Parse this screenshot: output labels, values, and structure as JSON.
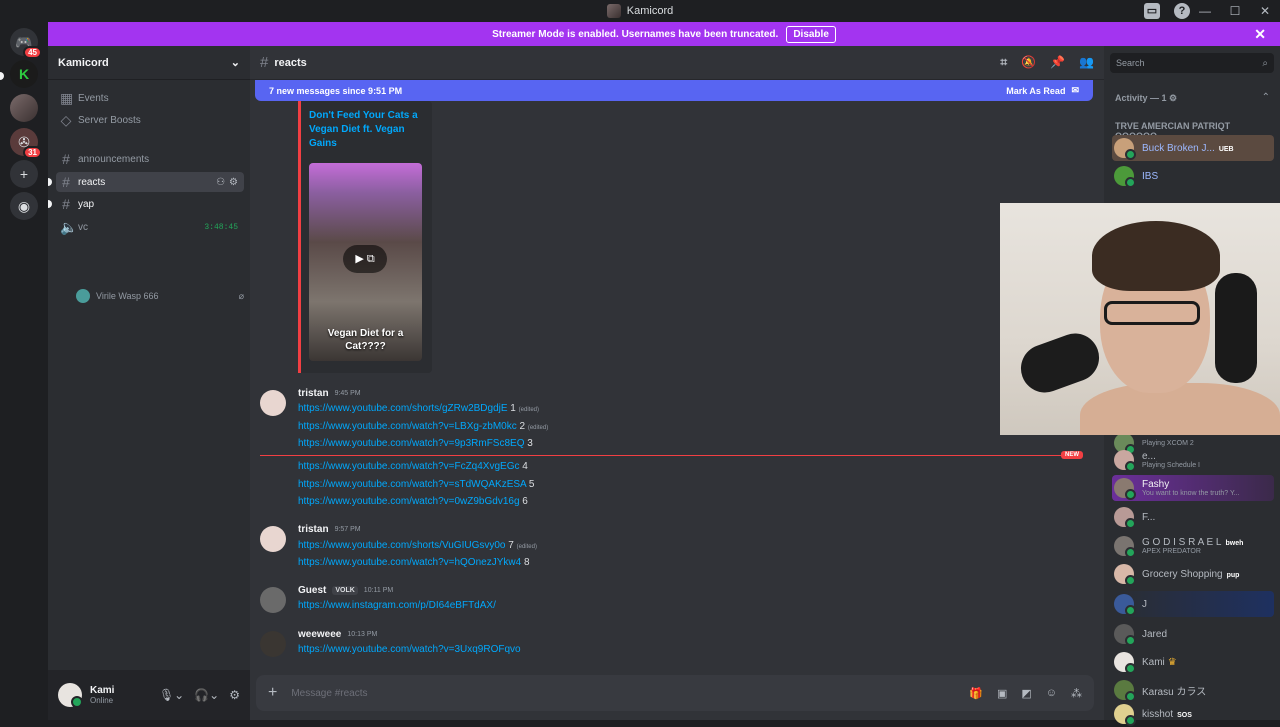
{
  "window": {
    "title": "Kamicord"
  },
  "streamer_bar": {
    "text": "Streamer Mode is enabled. Usernames have been truncated.",
    "button": "Disable"
  },
  "guilds": [
    {
      "badge": "45"
    },
    {
      "badge": ""
    },
    {
      "badge": ""
    },
    {
      "badge": "31"
    }
  ],
  "sidebar": {
    "server_name": "Kamicord",
    "items": [
      {
        "label": "Events"
      },
      {
        "label": "Server Boosts"
      },
      {
        "label": "announcements"
      },
      {
        "label": "reacts"
      },
      {
        "label": "yap"
      },
      {
        "label": "vc",
        "time": "3:48:45"
      }
    ],
    "vc_user": "Virile Wasp 666"
  },
  "user_panel": {
    "name": "Kami",
    "status": "Online"
  },
  "chat": {
    "channel": "reacts",
    "new_bar": {
      "text": "7 new messages since 9:51 PM",
      "mark": "Mark As Read"
    },
    "embed": {
      "title": "Don't Feed Your Cats a Vegan Diet ft. Vegan Gains",
      "caption": "Vegan Diet for a Cat????"
    },
    "new_label": "NEW",
    "messages": [
      {
        "author": "tristan",
        "time": "9:45 PM",
        "lines": [
          {
            "url": "https://www.youtube.com/shorts/gZRw2BDgdjE",
            "suffix": " 1",
            "edited": "(edited)"
          },
          {
            "url": "https://www.youtube.com/watch?v=LBXg-zbM0kc",
            "suffix": " 2",
            "edited": "(edited)"
          },
          {
            "url": "https://www.youtube.com/watch?v=9p3RmFSc8EQ",
            "suffix": " 3",
            "edited": ""
          },
          {
            "url": "https://www.youtube.com/watch?v=FcZq4XvgEGc",
            "suffix": " 4",
            "edited": ""
          },
          {
            "url": "https://www.youtube.com/watch?v=sTdWQAKzESA",
            "suffix": " 5",
            "edited": ""
          },
          {
            "url": "https://www.youtube.com/watch?v=0wZ9bGdv16g",
            "suffix": " 6",
            "edited": ""
          }
        ]
      },
      {
        "author": "tristan",
        "time": "9:57 PM",
        "lines": [
          {
            "url": "https://www.youtube.com/shorts/VuGIUGsvy0o",
            "suffix": " 7",
            "edited": "(edited)"
          },
          {
            "url": "https://www.youtube.com/watch?v=hQOnezJYkw4",
            "suffix": " 8",
            "edited": ""
          }
        ]
      },
      {
        "author": "Guest",
        "tag": "VOLK",
        "time": "10:11 PM",
        "lines": [
          {
            "url": "https://www.instagram.com/p/DI64eBFTdAX/",
            "suffix": "",
            "edited": ""
          }
        ]
      },
      {
        "author": "weeweee",
        "time": "10:13 PM",
        "lines": [
          {
            "url": "https://www.youtube.com/watch?v=3Uxq9ROFqvo",
            "suffix": "",
            "edited": ""
          }
        ]
      }
    ],
    "composer_placeholder": "Message #reacts"
  },
  "members": {
    "search_placeholder": "Search",
    "activity_header": "Activity — 1",
    "role_header": "TRVE AMERCIAN PATRIQT QQQQQQ...",
    "list": [
      {
        "name": "Buck Broken J...",
        "badge": "UEB",
        "activity": "",
        "color": "#c8a07a"
      },
      {
        "name": "IBS",
        "badge": "",
        "activity": "",
        "color": "#4c9a3a"
      },
      {
        "name": "",
        "badge": "",
        "activity": "Playing XCOM 2",
        "color": "#6a8a5a"
      },
      {
        "name": "e...",
        "badge": "",
        "activity": "Playing Schedule I",
        "color": "#c9a7a0"
      },
      {
        "name": "Fashy",
        "badge": "",
        "activity": "You want to know the truth? Y...",
        "color": "#8a7a70"
      },
      {
        "name": "F...",
        "badge": "",
        "activity": "",
        "color": "#b89a96"
      },
      {
        "name": "G O D I S R A E L",
        "badge": "bweh",
        "activity": "APEX PREDATOR",
        "color": "#7a7470"
      },
      {
        "name": "Grocery Shopping",
        "badge": "pup",
        "activity": "",
        "color": "#d8b8a8"
      },
      {
        "name": "J",
        "badge": "",
        "activity": "",
        "color": "#3a5a9a"
      },
      {
        "name": "Jared",
        "badge": "",
        "activity": "",
        "color": "#5a5a5a"
      },
      {
        "name": "Kami",
        "badge": "",
        "activity": "",
        "color": "#e8e4e0"
      },
      {
        "name": "Karasu カラス",
        "badge": "",
        "activity": "",
        "color": "#5a7a40"
      },
      {
        "name": "kisshot",
        "badge": "SOS",
        "activity": "",
        "color": "#e0d090"
      }
    ]
  },
  "colors": {
    "accent": "#5865f2",
    "streamer": "#a334f0",
    "new": "#f23f43",
    "link": "#00a8fc"
  }
}
